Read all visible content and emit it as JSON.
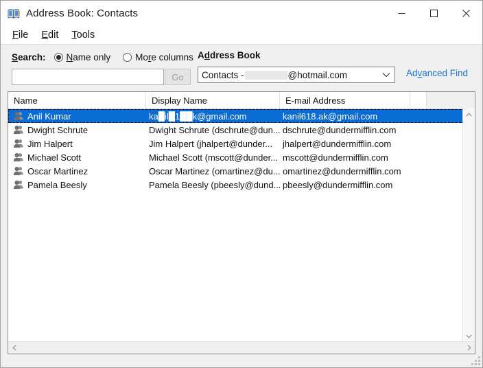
{
  "window": {
    "title": "Address Book: Contacts",
    "icon": "address-book-icon",
    "minimize_label": "–",
    "maximize_label": "□",
    "close_label": "✕"
  },
  "menubar": {
    "items": [
      {
        "pre": "",
        "acc": "F",
        "post": "ile"
      },
      {
        "pre": "",
        "acc": "E",
        "post": "dit"
      },
      {
        "pre": "",
        "acc": "T",
        "post": "ools"
      }
    ]
  },
  "toolbar": {
    "search_label_pre": "",
    "search_label_acc": "S",
    "search_label_post": "earch:",
    "radios": [
      {
        "label_pre": "",
        "label_acc": "N",
        "label_post": "ame only",
        "selected": true
      },
      {
        "label_pre": "Mo",
        "label_acc": "r",
        "label_post": "e columns",
        "selected": false
      }
    ],
    "address_book_label_pre": "A",
    "address_book_label_acc": "d",
    "address_book_label_post": "dress Book",
    "search_value": "",
    "search_placeholder": "",
    "go_label": "Go",
    "combo_prefix": "Contacts -",
    "combo_suffix": "@hotmail.com",
    "combo_redacted": true,
    "combo_arrow": "chevron-down-icon",
    "advanced_find_pre": "Ad",
    "advanced_find_acc": "v",
    "advanced_find_post": "anced Find",
    "link_color": "#1a6fd4"
  },
  "list": {
    "columns": [
      "Name",
      "Display Name",
      "E-mail Address"
    ],
    "rows": [
      {
        "name": "Anil Kumar",
        "display_name": "ka█il█1██k@gmail.com",
        "email": "kanil618.ak@gmail.com",
        "selected": true
      },
      {
        "name": "Dwight Schrute",
        "display_name": "Dwight Schrute (dschrute@dun...",
        "email": "dschrute@dundermifflin.com",
        "selected": false
      },
      {
        "name": "Jim Halpert",
        "display_name": "Jim Halpert (jhalpert@dunder...",
        "email": "jhalpert@dundermifflin.com",
        "selected": false
      },
      {
        "name": "Michael Scott",
        "display_name": "Michael Scott (mscott@dunder...",
        "email": "mscott@dundermifflin.com",
        "selected": false
      },
      {
        "name": "Oscar Martinez",
        "display_name": "Oscar Martinez (omartinez@du...",
        "email": "omartinez@dundermifflin.com",
        "selected": false
      },
      {
        "name": "Pamela Beesly",
        "display_name": "Pamela Beesly (pbeesly@dund...",
        "email": "pbeesly@dundermifflin.com",
        "selected": false
      }
    ],
    "selection_color": "#0a6cd4",
    "scroll_up": "chevron-up-icon",
    "scroll_down": "chevron-down-icon",
    "scroll_left": "chevron-left-icon",
    "scroll_right": "chevron-right-icon"
  }
}
